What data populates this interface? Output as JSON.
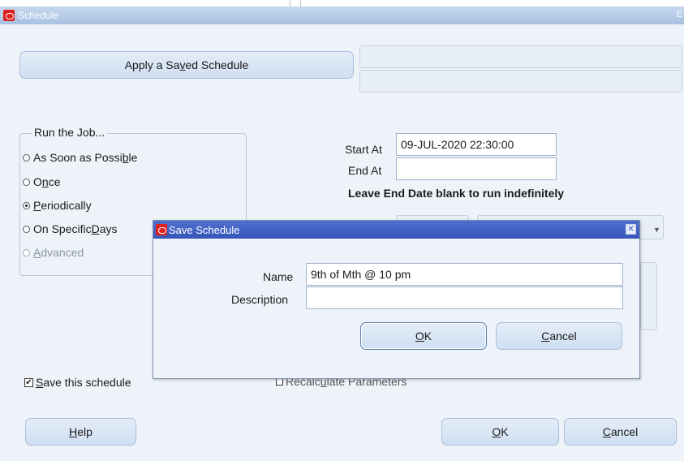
{
  "window": {
    "title": "Schedule",
    "title_right_mark": "E"
  },
  "main": {
    "apply_saved_schedule": {
      "pre": "Apply a Sa",
      "accel": "v",
      "post": "ed Schedule"
    },
    "run_job": {
      "legend": "Run the Job...",
      "options": [
        {
          "pre": "As Soon as Possi",
          "accel": "b",
          "post": "le",
          "checked": false,
          "disabled": false
        },
        {
          "pre": "O",
          "accel": "n",
          "post": "ce",
          "checked": false,
          "disabled": false
        },
        {
          "pre": "",
          "accel": "P",
          "post": "eriodically",
          "checked": true,
          "disabled": false
        },
        {
          "pre": "On Specific ",
          "accel": "D",
          "post": "ays",
          "checked": false,
          "disabled": false
        },
        {
          "pre": "",
          "accel": "A",
          "post": "dvanced",
          "checked": false,
          "disabled": true
        }
      ]
    },
    "start_at_label": "Start At",
    "start_at_value": "09-JUL-2020 22:30:00",
    "end_at_label": "End At",
    "end_at_value": "",
    "end_note": "Leave End Date blank to run indefinitely",
    "save_schedule": {
      "checked": true,
      "accel": "S",
      "post": "ave this schedule"
    },
    "recalculate": {
      "pre": "Recalc",
      "accel": "u",
      "post": "late Parameters",
      "checked": false
    },
    "help_button": {
      "accel": "H",
      "post": "elp"
    },
    "ok_button": {
      "accel": "O",
      "post": "K"
    },
    "cancel_button": {
      "accel": "C",
      "post": "ancel"
    }
  },
  "dialog": {
    "title": "Save Schedule",
    "name_label": "Name",
    "name_value": "9th of Mth @ 10 pm",
    "description_label": "Description",
    "description_value": "",
    "ok_button": {
      "accel": "O",
      "post": "K"
    },
    "cancel_button": {
      "accel": "C",
      "post": "ancel"
    }
  }
}
